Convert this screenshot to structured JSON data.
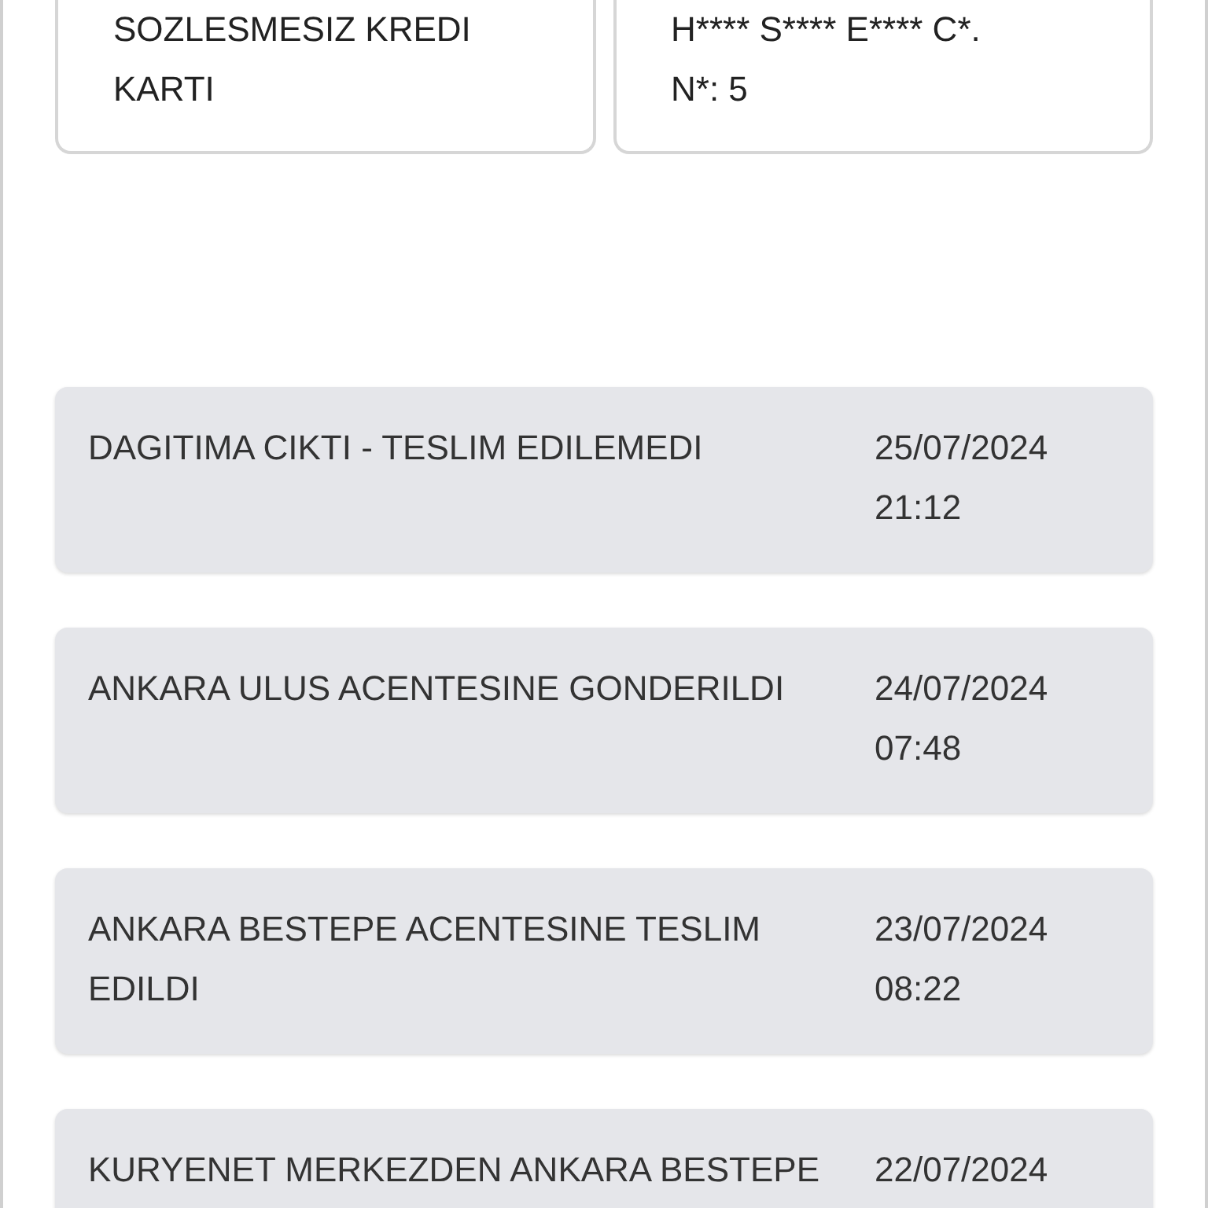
{
  "info_cards": [
    {
      "lines": [
        "SOZLESMESIZ KREDI",
        "KARTI"
      ]
    },
    {
      "lines": [
        "H**** S**** E**** C*.",
        "N*: 5"
      ]
    }
  ],
  "events": [
    {
      "status": "DAGITIMA CIKTI - TESLIM EDILEMEDI",
      "date": "25/07/2024",
      "time": "21:12"
    },
    {
      "status": "ANKARA ULUS ACENTESINE GONDERILDI",
      "date": "24/07/2024",
      "time": "07:48"
    },
    {
      "status": "ANKARA BESTEPE ACENTESINE TESLIM EDILDI",
      "date": "23/07/2024",
      "time": "08:22"
    },
    {
      "status": "KURYENET MERKEZDEN ANKARA BESTEPE",
      "date": "22/07/2024"
    }
  ]
}
